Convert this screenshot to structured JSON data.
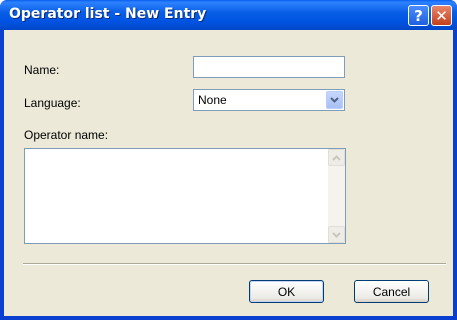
{
  "window": {
    "title": "Operator list - New Entry",
    "help_symbol": "?",
    "close_symbol": "✕",
    "accent_color": "#0054e3"
  },
  "form": {
    "name_label": "Name:",
    "name_value": "",
    "language_label": "Language:",
    "language_selected": "None",
    "operator_name_label": "Operator name:",
    "operator_name_value": ""
  },
  "buttons": {
    "ok_label": "OK",
    "cancel_label": "Cancel"
  }
}
